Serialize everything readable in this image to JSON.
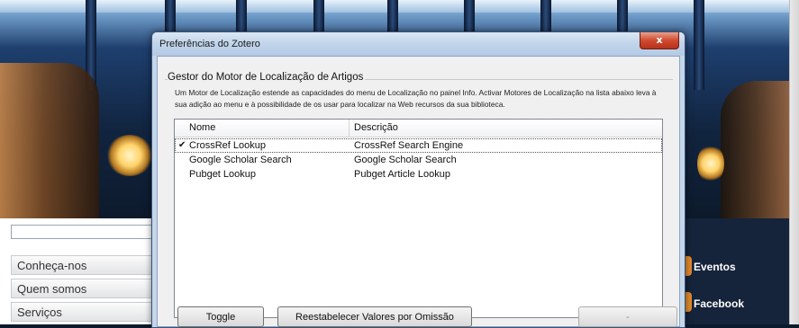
{
  "website": {
    "nav": [
      "Conheça-nos",
      "Quem somos",
      "Serviços"
    ],
    "right_links": [
      "Eventos",
      "Facebook"
    ]
  },
  "dialog": {
    "title": "Preferências do Zotero",
    "close_label": "x",
    "group_title": "Gestor do Motor de Localização de Artigos",
    "description": "Um Motor de Localização estende as capacidades do menu de Localização no painel Info. Activar Motores de Localização na lista abaixo leva à sua adição ao menu e à possibilidade de os usar para localizar na Web recursos da sua biblioteca.",
    "columns": {
      "name": "Nome",
      "description": "Descrição"
    },
    "engines": [
      {
        "check": "✔",
        "name": "CrossRef Lookup",
        "description": "CrossRef Search Engine",
        "enabled": true
      },
      {
        "check": "",
        "name": "Google Scholar Search",
        "description": "Google Scholar Search",
        "enabled": false
      },
      {
        "check": "",
        "name": "Pubget Lookup",
        "description": "Pubget Article Lookup",
        "enabled": false
      }
    ],
    "buttons": {
      "toggle": "Toggle",
      "reset": "Reestabelecer Valores por Omissão",
      "minus": "-"
    }
  },
  "colors": {
    "accent_orange": "#e08a2c",
    "close_red": "#cf4a2f",
    "titlebar": "#c4d6ea"
  }
}
